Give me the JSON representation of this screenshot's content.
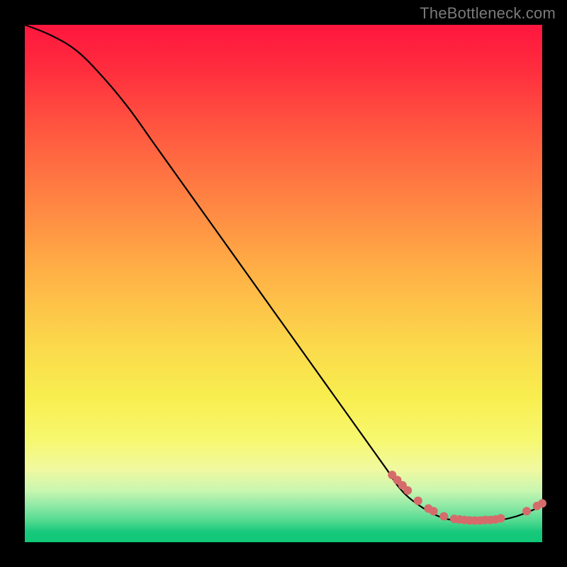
{
  "watermark": "TheBottleneck.com",
  "chart_data": {
    "type": "line",
    "title": "",
    "xlabel": "",
    "ylabel": "",
    "xlim": [
      0,
      100
    ],
    "ylim": [
      0,
      100
    ],
    "grid": false,
    "legend": false,
    "series": [
      {
        "name": "curve",
        "x": [
          0,
          5,
          10,
          15,
          20,
          25,
          30,
          35,
          40,
          45,
          50,
          55,
          60,
          65,
          70,
          72,
          75,
          80,
          85,
          90,
          95,
          100
        ],
        "values": [
          100,
          98,
          95,
          90,
          84,
          77,
          70,
          63,
          56,
          49,
          42,
          35,
          28,
          21,
          14,
          11,
          8,
          5,
          4,
          4,
          5,
          7
        ]
      }
    ],
    "markers": [
      {
        "x": 71,
        "y": 13
      },
      {
        "x": 72,
        "y": 12
      },
      {
        "x": 73,
        "y": 11
      },
      {
        "x": 74,
        "y": 10
      },
      {
        "x": 76,
        "y": 8
      },
      {
        "x": 78,
        "y": 6.5
      },
      {
        "x": 79,
        "y": 6
      },
      {
        "x": 81,
        "y": 5
      },
      {
        "x": 83,
        "y": 4.5
      },
      {
        "x": 84,
        "y": 4.4
      },
      {
        "x": 85,
        "y": 4.3
      },
      {
        "x": 86,
        "y": 4.2
      },
      {
        "x": 87,
        "y": 4.2
      },
      {
        "x": 88,
        "y": 4.2
      },
      {
        "x": 89,
        "y": 4.3
      },
      {
        "x": 90,
        "y": 4.3
      },
      {
        "x": 91,
        "y": 4.4
      },
      {
        "x": 92,
        "y": 4.6
      },
      {
        "x": 97,
        "y": 6
      },
      {
        "x": 99,
        "y": 7
      },
      {
        "x": 100,
        "y": 7.5
      }
    ],
    "colors": {
      "marker": "#d66b6b",
      "line": "#000000"
    }
  }
}
